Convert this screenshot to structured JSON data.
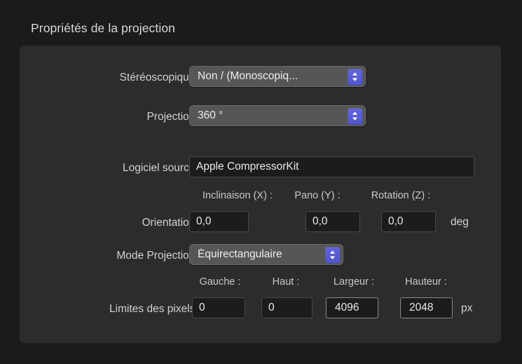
{
  "section": {
    "title": "Propriétés de la projection"
  },
  "rows": {
    "stereoscopic": {
      "label": "Stéréoscopique :",
      "value": "Non / (Monoscopiq..."
    },
    "projection": {
      "label": "Projection :",
      "value": "360 °"
    },
    "source_software": {
      "label": "Logiciel source :",
      "value": "Apple CompressorKit"
    },
    "orientation": {
      "label": "Orientation :",
      "headers": {
        "x": "Inclinaison (X) :",
        "y": "Pano (Y) :",
        "z": "Rotation (Z) :"
      },
      "values": {
        "x": "0,0",
        "y": "0,0",
        "z": "0,0"
      },
      "unit": "deg"
    },
    "projection_mode": {
      "label": "Mode Projection :",
      "value": "Équirectangulaire"
    },
    "pixel_bounds": {
      "label": "Limites des pixels :",
      "headers": {
        "left": "Gauche :",
        "top": "Haut :",
        "width": "Largeur :",
        "height": "Hauteur :"
      },
      "values": {
        "left": "0",
        "top": "0",
        "width": "4096",
        "height": "2048"
      },
      "unit": "px"
    }
  },
  "icons": {
    "stepper": "stepper-up-down-icon"
  },
  "colors": {
    "accent": "#5a5fd4",
    "panel": "#2c2c2c",
    "window": "#1b1b1b",
    "field": "#1c1c1c",
    "popup": "#565656",
    "text": "#d2d2d2"
  }
}
